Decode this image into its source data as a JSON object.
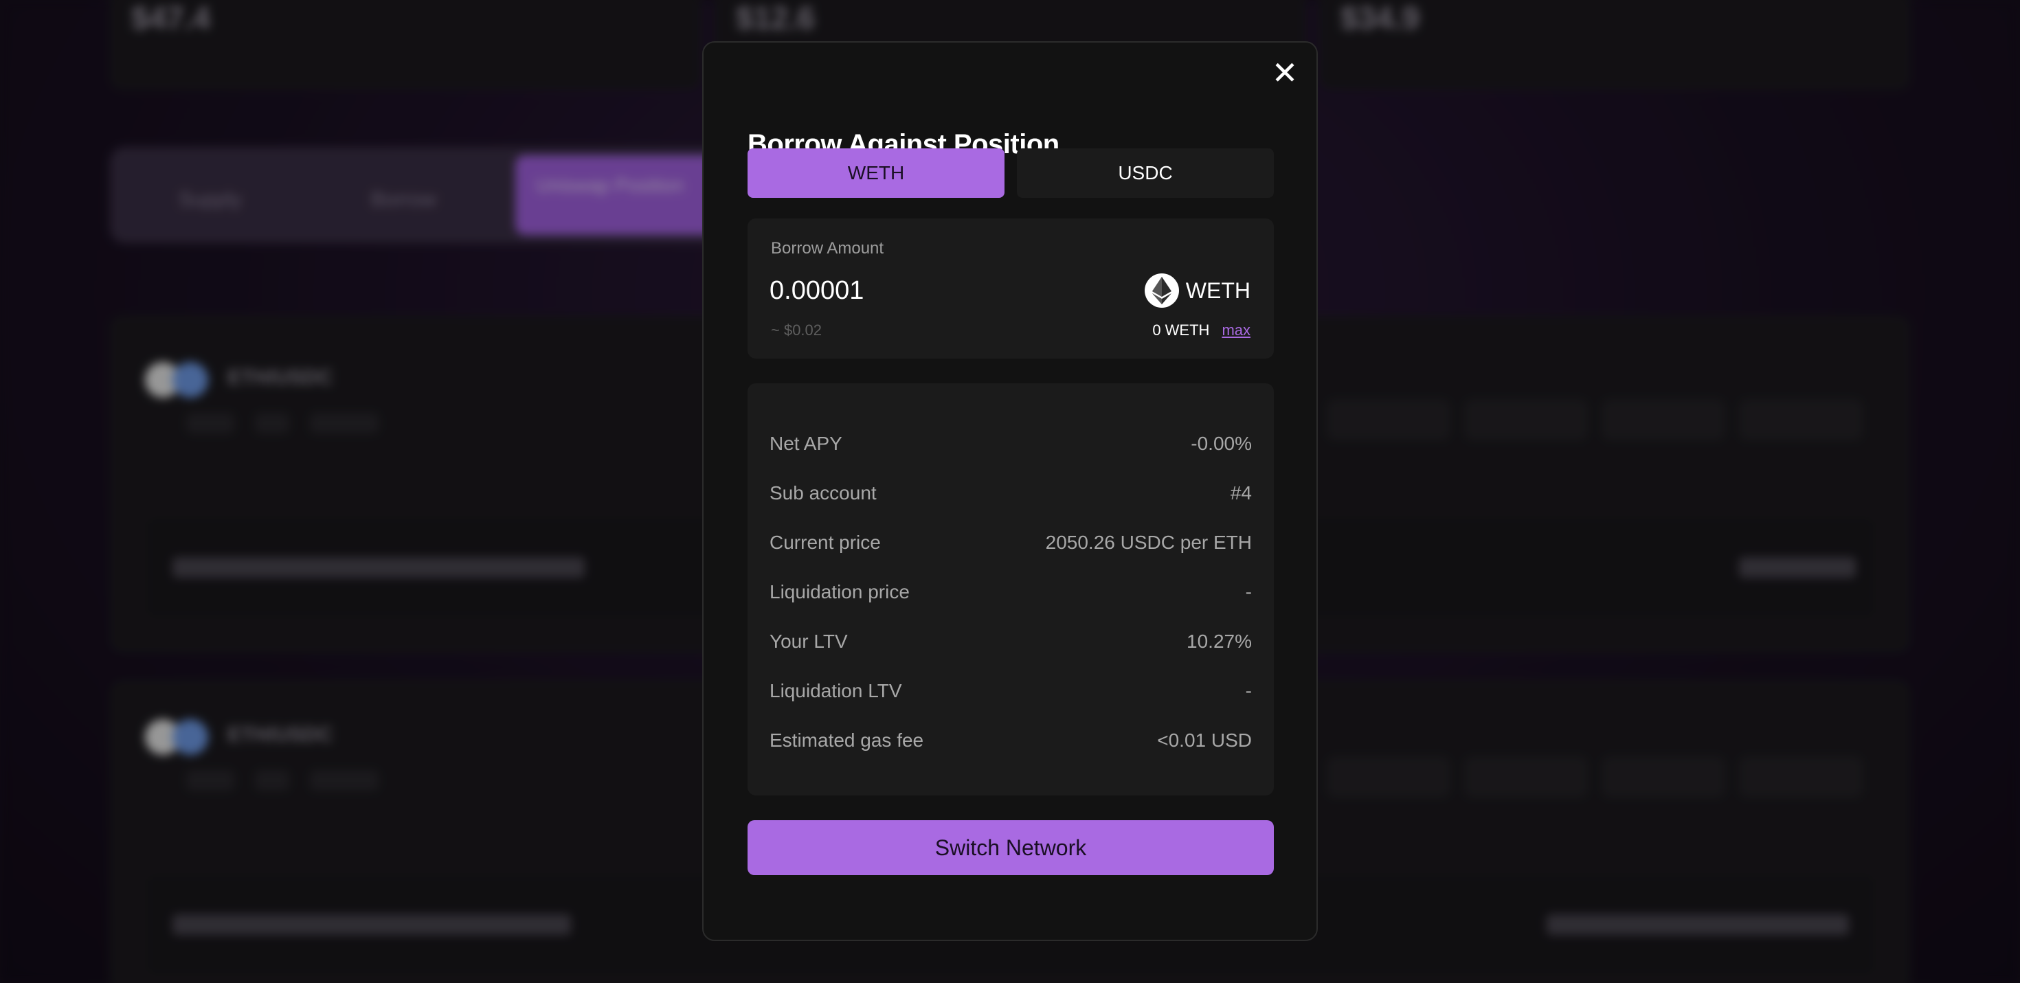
{
  "modal": {
    "title": "Borrow Against Position",
    "close_icon": "close-icon",
    "tabs": [
      {
        "label": "WETH",
        "active": true
      },
      {
        "label": "USDC",
        "active": false
      }
    ],
    "amount": {
      "label": "Borrow Amount",
      "value": "0.00001",
      "usd_estimate": "~ $0.02",
      "token": "WETH",
      "token_icon": "ethereum-icon",
      "balance": "0 WETH",
      "max_label": "max"
    },
    "info": [
      {
        "label": "Net APY",
        "value": "-0.00%"
      },
      {
        "label": "Sub account",
        "value": "#4"
      },
      {
        "label": "Current price",
        "value": "2050.26 USDC per ETH"
      },
      {
        "label": "Liquidation price",
        "value": "-"
      },
      {
        "label": "Your LTV",
        "value": "10.27%"
      },
      {
        "label": "Liquidation LTV",
        "value": "-"
      },
      {
        "label": "Estimated gas fee",
        "value": "<0.01 USD"
      }
    ],
    "action_label": "Switch Network"
  },
  "background": {
    "stats": [
      "$47.4",
      "$12.6",
      "$34.9"
    ],
    "tabs": [
      "Supply",
      "Borrow"
    ],
    "active_tab": "Uniswap Position",
    "positions": [
      {
        "pair": "ETH/USDC"
      },
      {
        "pair": "ETH/USDC"
      }
    ]
  },
  "colors": {
    "accent": "#a96ae2",
    "modal_bg": "#121212",
    "panel_bg": "#1b1b1b"
  }
}
